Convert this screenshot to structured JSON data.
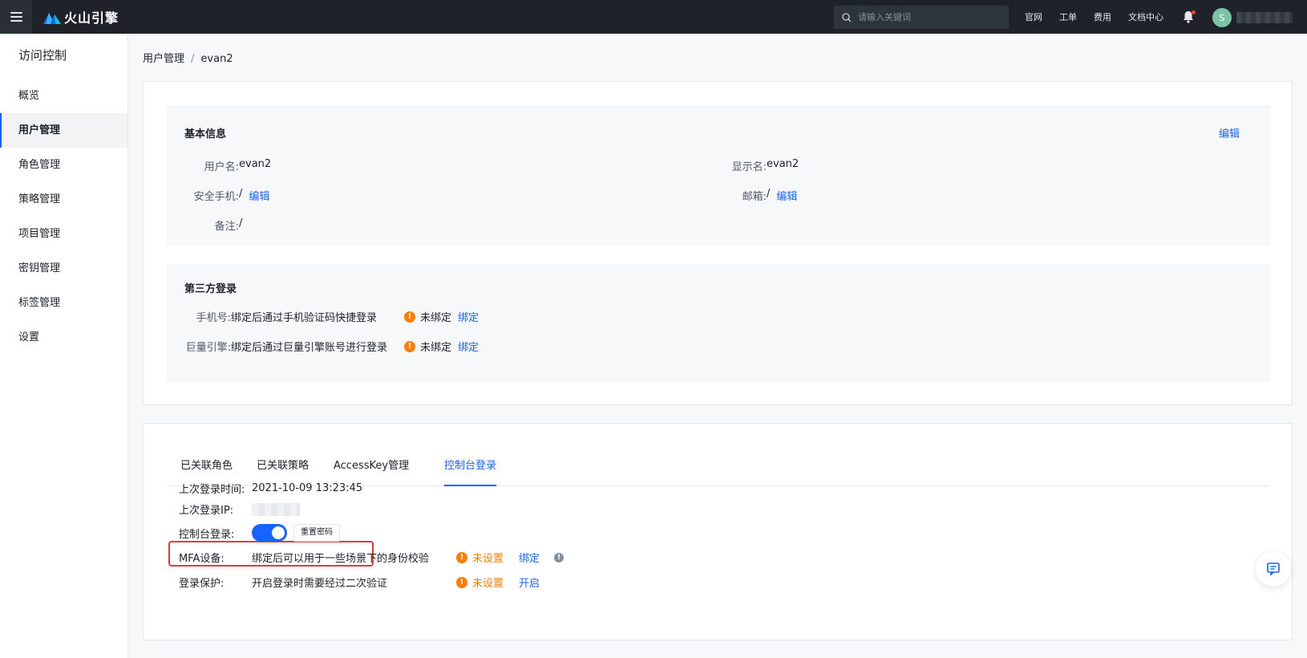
{
  "topbar": {
    "brand": "火山引擎",
    "search_placeholder": "请输入关键词",
    "links": [
      "官网",
      "工单",
      "费用",
      "文档中心"
    ],
    "avatar_initial": "S"
  },
  "sidebar": {
    "title": "访问控制",
    "items": [
      {
        "label": "概览"
      },
      {
        "label": "用户管理"
      },
      {
        "label": "角色管理"
      },
      {
        "label": "策略管理"
      },
      {
        "label": "项目管理"
      },
      {
        "label": "密钥管理"
      },
      {
        "label": "标签管理"
      },
      {
        "label": "设置"
      }
    ],
    "active_index": 1
  },
  "breadcrumb": {
    "parent": "用户管理",
    "separator": "/",
    "current": "evan2"
  },
  "basic_info": {
    "title": "基本信息",
    "edit_label": "编辑",
    "username_label": "用户名:",
    "username": "evan2",
    "display_name_label": "显示名:",
    "display_name": "evan2",
    "phone_label": "安全手机:",
    "phone_value": "/",
    "phone_edit": "编辑",
    "email_label": "邮箱:",
    "email_value": "/",
    "email_edit": "编辑",
    "note_label": "备注:",
    "note_value": "/"
  },
  "third_party": {
    "title": "第三方登录",
    "rows": [
      {
        "label": "手机号:",
        "desc": "绑定后通过手机验证码快捷登录",
        "status": "未绑定",
        "action": "绑定"
      },
      {
        "label": "巨量引擎:",
        "desc": "绑定后通过巨量引擎账号进行登录",
        "status": "未绑定",
        "action": "绑定"
      }
    ]
  },
  "tabs": {
    "items": [
      "已关联角色",
      "已关联策略",
      "AccessKey管理",
      "控制台登录"
    ],
    "active_index": 3
  },
  "console_login": {
    "last_login_time_label": "上次登录时间:",
    "last_login_time": "2021-10-09 13:23:45",
    "last_login_ip_label": "上次登录IP:",
    "console_login_label": "控制台登录:",
    "console_login_enabled": true,
    "reset_password": "重置密码",
    "mfa_label": "MFA设备:",
    "mfa_desc": "绑定后可以用于一些场景下的身份校验",
    "mfa_status": "未设置",
    "mfa_action": "绑定",
    "protect_label": "登录保护:",
    "protect_desc": "开启登录时需要经过二次验证",
    "protect_status": "未设置",
    "protect_action": "开启"
  },
  "colors": {
    "primary": "#1664ff",
    "warning": "#ff7d00",
    "highlight_border": "#e53935",
    "topbar_bg": "#1f2329"
  }
}
